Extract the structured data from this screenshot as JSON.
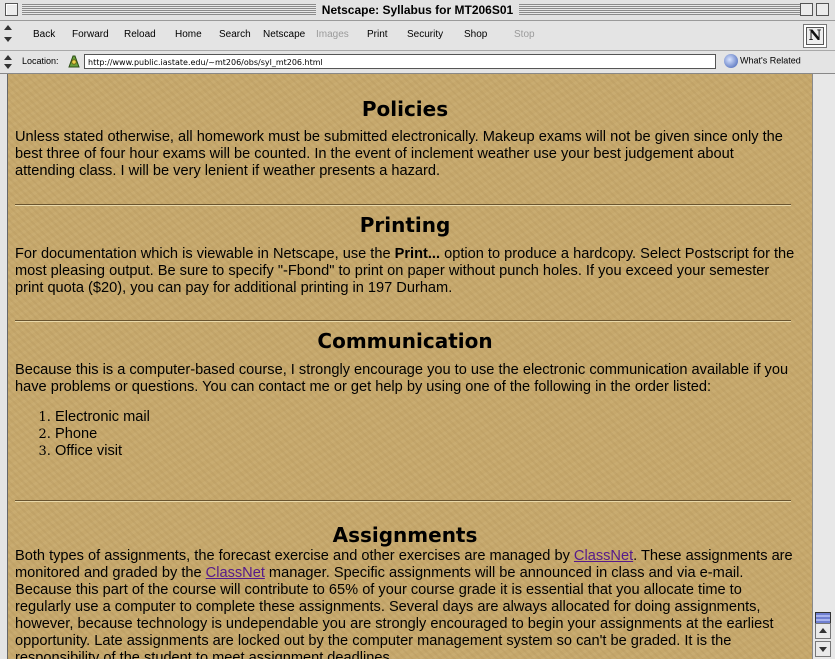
{
  "window": {
    "title": "Netscape: Syllabus for MT206S01"
  },
  "toolbar": {
    "back": "Back",
    "forward": "Forward",
    "reload": "Reload",
    "home": "Home",
    "search": "Search",
    "netscape": "Netscape",
    "images": "Images",
    "print": "Print",
    "security": "Security",
    "shop": "Shop",
    "stop": "Stop"
  },
  "location": {
    "label": "Location:",
    "url": "http://www.public.iastate.edu/~mt206/obs/syl_mt206.html",
    "related": "What's Related"
  },
  "page": {
    "policies": {
      "heading": "Policies",
      "body": "Unless stated otherwise, all homework must be submitted electronically. Makeup exams will not be given since only the best three of four hour exams will be counted. In the event of inclement weather use your best judgement about attending class. I will be very lenient if weather presents a hazard."
    },
    "printing": {
      "heading": "Printing",
      "body_1": "For documentation which is viewable in Netscape, use the ",
      "bold": "Print...",
      "body_2": " option to produce a hardcopy. Select Postscript for the most pleasing output. Be sure to specify \"-Fbond\" to print on paper without punch holes.  If you exceed your semester print quota ($20), you can pay for additional printing in 197 Durham."
    },
    "communication": {
      "heading": "Communication",
      "body": "Because this is a computer-based course, I strongly encourage you to use the electronic communication available if you have problems or questions. You can contact me or get help by using one of the following in the order listed:",
      "items": [
        "Electronic mail",
        "Phone",
        "Office visit"
      ]
    },
    "assignments": {
      "heading": "Assignments",
      "t1": "Both types of assignments, the forecast exercise and other exercises are managed by ",
      "link1": "ClassNet",
      "t2": ". These assignments are monitored and graded by the ",
      "link2": "ClassNet",
      "t3": " manager. Specific assignments will be announced in class and via e-mail. Because this part of the course will contribute to 65% of your course grade it is essential that you allocate time to regularly use a computer to complete these assignments. Several days are always allocated for doing assignments, however, because technology is undependable you are strongly encouraged to begin your assignments at the earliest opportunity. Late assignments are locked out by the computer management system so can't be graded. It is the responsibility of the student to meet assignment deadlines."
    }
  },
  "colors": {
    "page_background": "#c6a86c",
    "link": "#551a8b"
  }
}
